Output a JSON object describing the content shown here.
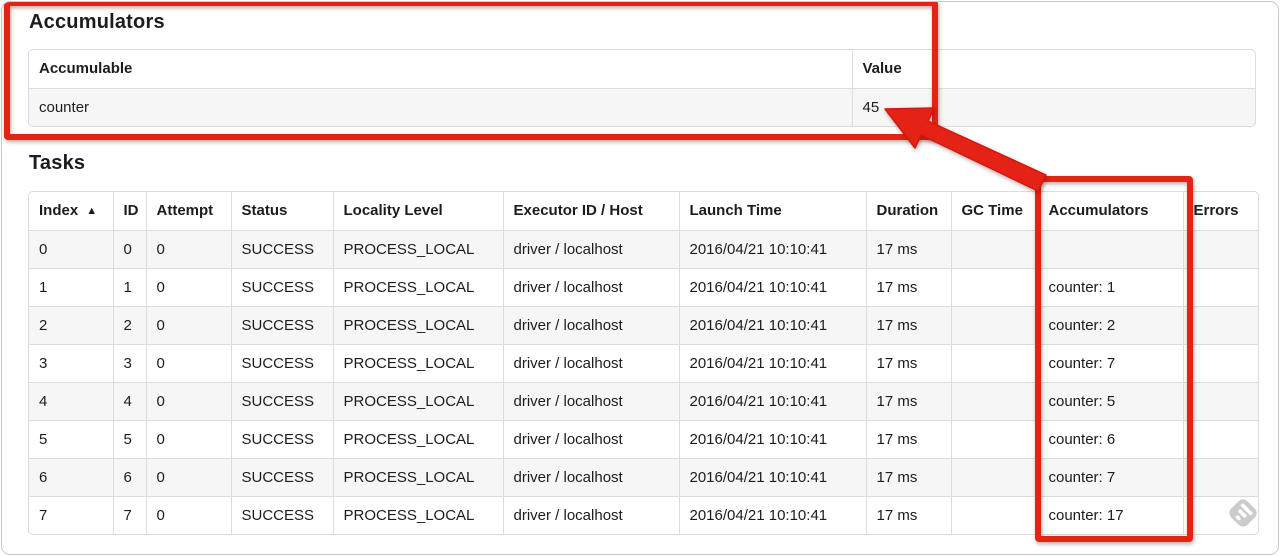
{
  "colors": {
    "annotation_red": "#e42316",
    "table_border": "#dcdcdc",
    "row_stripe": "#f6f6f6",
    "text": "#1c1c1c",
    "watermark_gray": "#c7c7c7"
  },
  "accumulators_section": {
    "title": "Accumulators",
    "table": {
      "headers": [
        "Accumulable",
        "Value"
      ],
      "sorted_column": -1,
      "sort_glyph": "",
      "rows": [
        [
          "counter",
          "45"
        ]
      ]
    }
  },
  "tasks_section": {
    "title": "Tasks",
    "table": {
      "headers": [
        "Index",
        "ID",
        "Attempt",
        "Status",
        "Locality Level",
        "Executor ID / Host",
        "Launch Time",
        "Duration",
        "GC Time",
        "Accumulators",
        "Errors"
      ],
      "sorted_column": 0,
      "sort_glyph": "▲",
      "rows": [
        [
          "0",
          "0",
          "0",
          "SUCCESS",
          "PROCESS_LOCAL",
          "driver / localhost",
          "2016/04/21 10:10:41",
          "17 ms",
          "",
          "",
          ""
        ],
        [
          "1",
          "1",
          "0",
          "SUCCESS",
          "PROCESS_LOCAL",
          "driver / localhost",
          "2016/04/21 10:10:41",
          "17 ms",
          "",
          "counter: 1",
          ""
        ],
        [
          "2",
          "2",
          "0",
          "SUCCESS",
          "PROCESS_LOCAL",
          "driver / localhost",
          "2016/04/21 10:10:41",
          "17 ms",
          "",
          "counter: 2",
          ""
        ],
        [
          "3",
          "3",
          "0",
          "SUCCESS",
          "PROCESS_LOCAL",
          "driver / localhost",
          "2016/04/21 10:10:41",
          "17 ms",
          "",
          "counter: 7",
          ""
        ],
        [
          "4",
          "4",
          "0",
          "SUCCESS",
          "PROCESS_LOCAL",
          "driver / localhost",
          "2016/04/21 10:10:41",
          "17 ms",
          "",
          "counter: 5",
          ""
        ],
        [
          "5",
          "5",
          "0",
          "SUCCESS",
          "PROCESS_LOCAL",
          "driver / localhost",
          "2016/04/21 10:10:41",
          "17 ms",
          "",
          "counter: 6",
          ""
        ],
        [
          "6",
          "6",
          "0",
          "SUCCESS",
          "PROCESS_LOCAL",
          "driver / localhost",
          "2016/04/21 10:10:41",
          "17 ms",
          "",
          "counter: 7",
          ""
        ],
        [
          "7",
          "7",
          "0",
          "SUCCESS",
          "PROCESS_LOCAL",
          "driver / localhost",
          "2016/04/21 10:10:41",
          "17 ms",
          "",
          "counter: 17",
          ""
        ]
      ]
    }
  },
  "annotations": {
    "box_1_target": "accumulators-section",
    "box_2_target": "tasks-accumulators-column",
    "arrow_meaning": "points from tasks accumulators column to accumulator value 45"
  }
}
